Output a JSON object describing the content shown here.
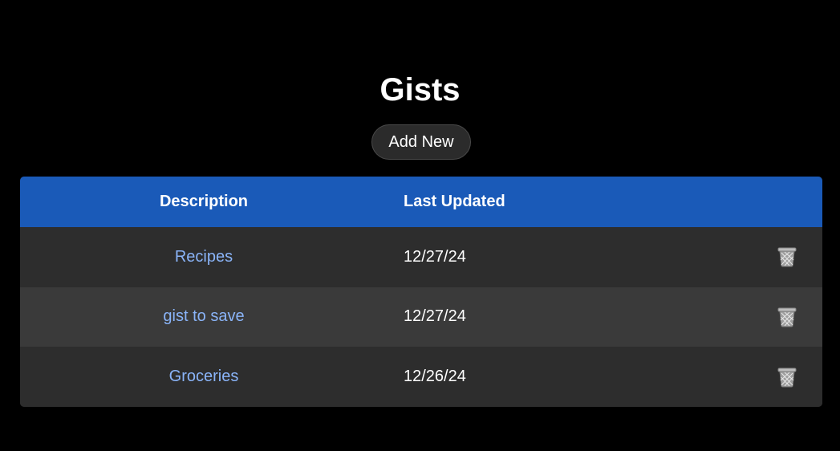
{
  "page": {
    "title": "Gists",
    "add_button_label": "Add New"
  },
  "table": {
    "headers": {
      "description": "Description",
      "last_updated": "Last Updated"
    },
    "rows": [
      {
        "description": "Recipes",
        "last_updated": "12/27/24",
        "action_icon": "trash-icon"
      },
      {
        "description": "gist to save",
        "last_updated": "12/27/24",
        "action_icon": "trash-icon"
      },
      {
        "description": "Groceries",
        "last_updated": "12/26/24",
        "action_icon": "trash-icon"
      }
    ]
  },
  "colors": {
    "background": "#000000",
    "header": "#1a5ab8",
    "row_odd": "#2d2d2d",
    "row_even": "#3a3a3a",
    "link": "#8ab4f8"
  }
}
